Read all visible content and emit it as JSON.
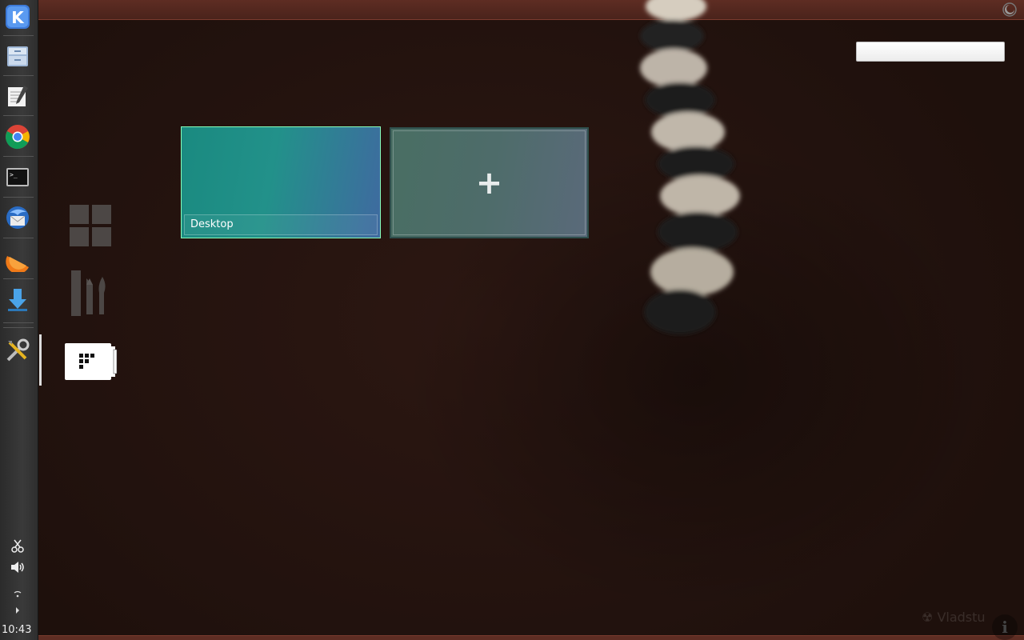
{
  "panel": {
    "launchers": [
      {
        "name": "kde-menu-icon"
      },
      {
        "name": "file-manager-icon"
      },
      {
        "name": "text-editor-icon"
      },
      {
        "name": "chrome-icon"
      },
      {
        "name": "terminal-icon"
      },
      {
        "name": "thunderbird-icon"
      },
      {
        "name": "orange-slice-icon"
      },
      {
        "name": "download-icon"
      },
      {
        "name": "system-settings-icon"
      }
    ],
    "clock": "10:43"
  },
  "activities": {
    "add_desktop_symbol": "+",
    "desktops": [
      {
        "label": "Desktop"
      }
    ]
  },
  "search": {
    "placeholder": "",
    "value": ""
  },
  "watermark": "Vladstu",
  "info_symbol": "i"
}
